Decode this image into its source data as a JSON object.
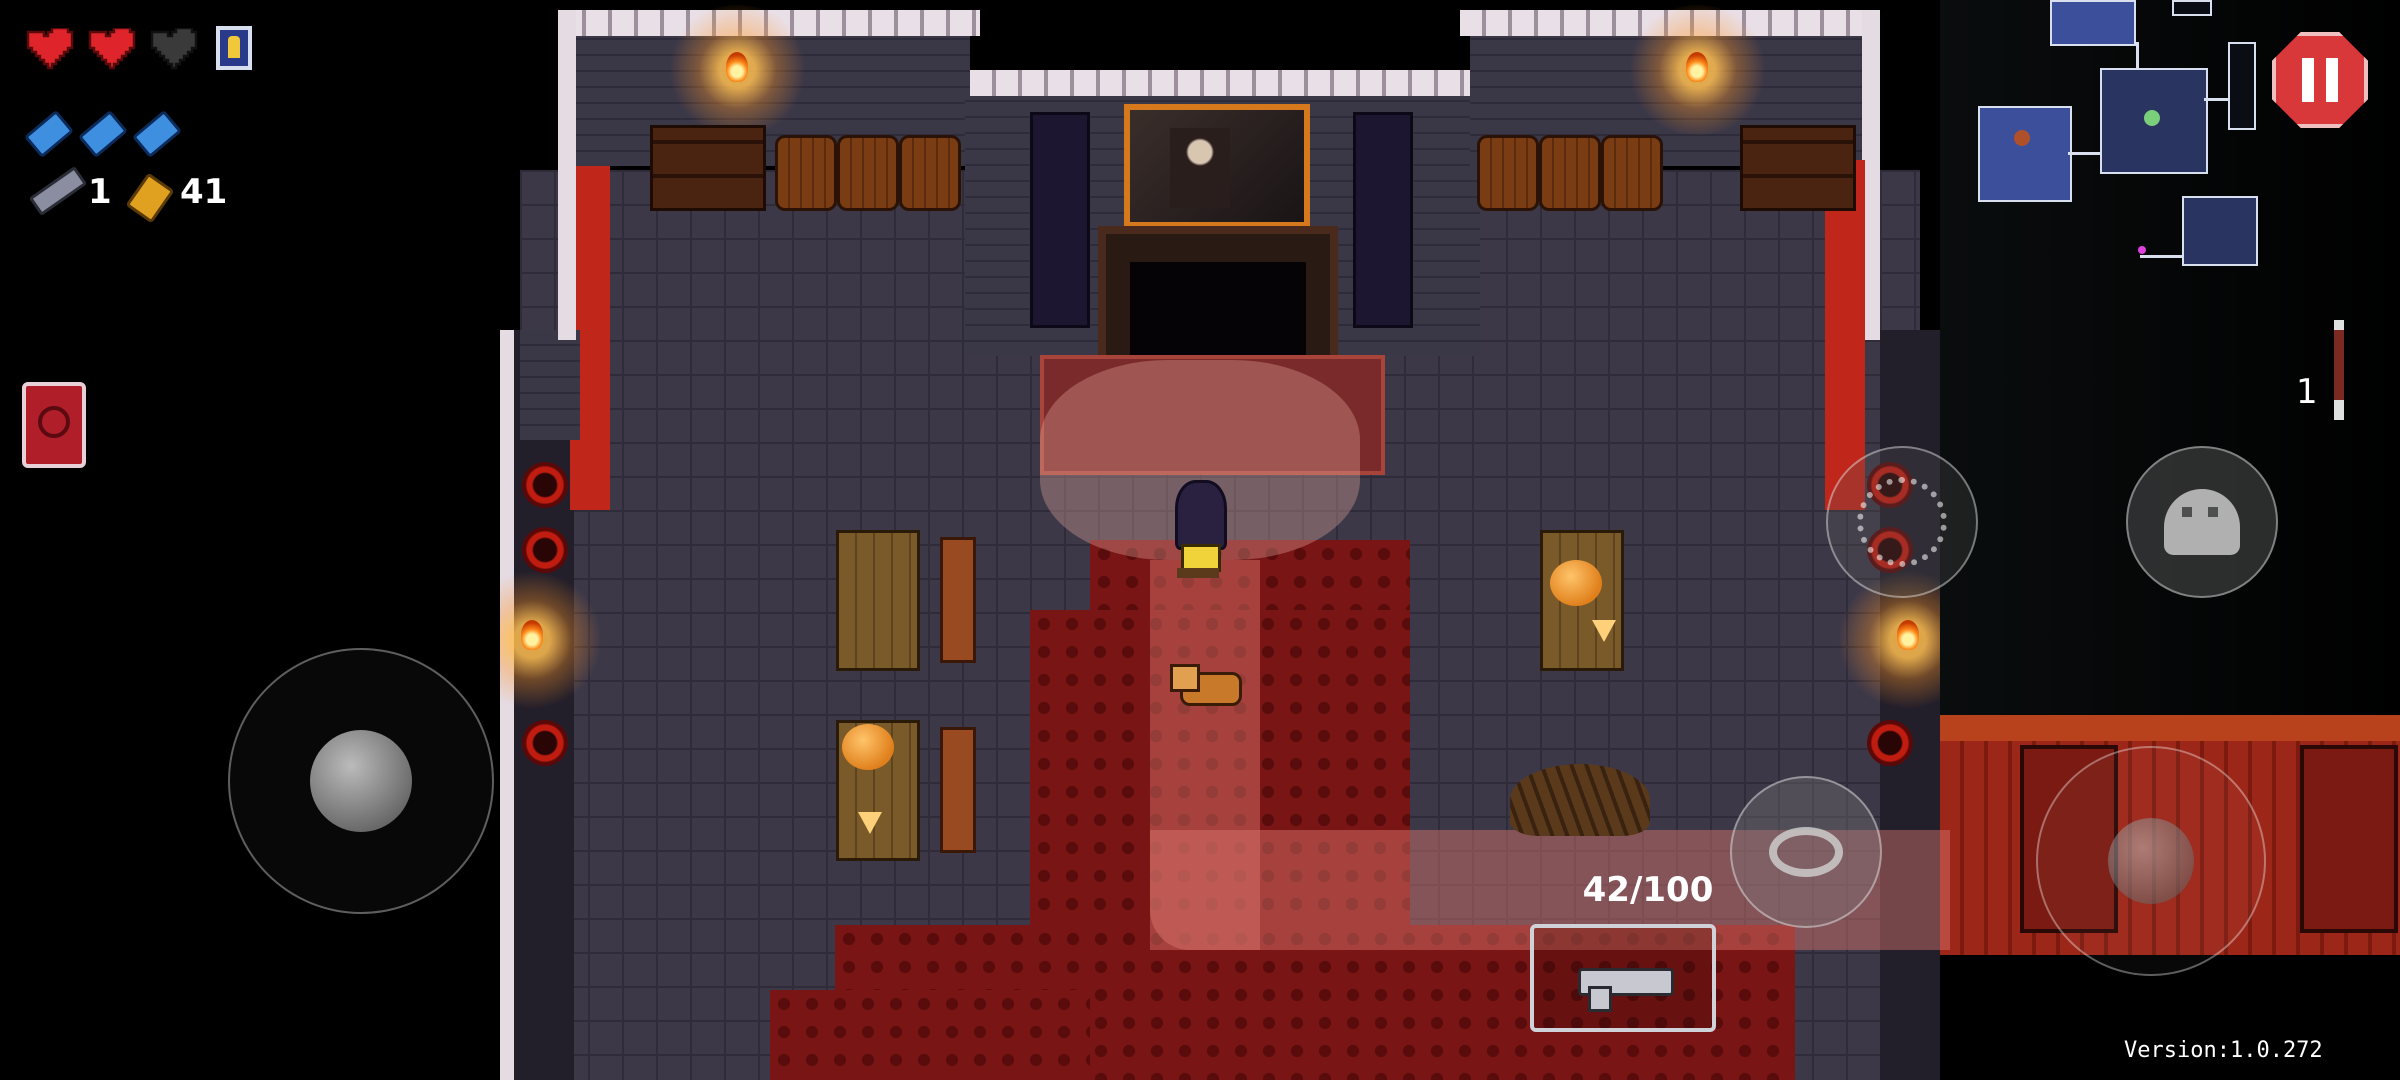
{
  "player": {
    "hearts": [
      "full",
      "full",
      "empty"
    ],
    "armor": 1,
    "blanks": 3,
    "keys": "1",
    "shells": "41"
  },
  "active_item": {
    "icon": "ammonomicon-book-icon"
  },
  "weapon": {
    "ammo": "42/100",
    "icon": "rusty-sidearm-gun-icon"
  },
  "side_item": {
    "count": "1",
    "icon": "key-item-icon"
  },
  "controls": {
    "pause_icon": "pause-icon",
    "blank_icon": "blank-ghost-icon",
    "interact_icon": "interact-icon",
    "reload_icon": "reload-icon"
  },
  "version": "Version:1.0.272",
  "colors": {
    "heart": "#e0242b",
    "blank": "#3f8fe0",
    "pause": "#d9383a",
    "minimap_room": "#3b4f9a"
  }
}
